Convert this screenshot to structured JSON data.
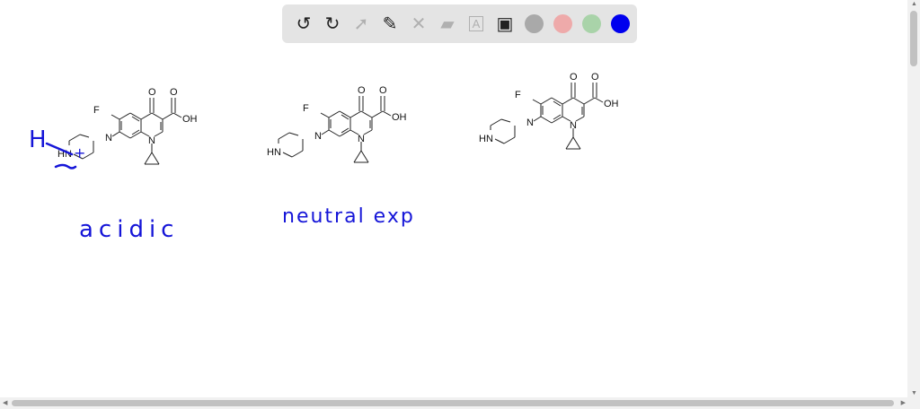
{
  "toolbar": {
    "tools": [
      {
        "name": "undo-icon",
        "glyph": "↺",
        "enabled": true
      },
      {
        "name": "redo-icon",
        "glyph": "↻",
        "enabled": true
      },
      {
        "name": "select-pointer-icon",
        "glyph": "➚",
        "enabled": false
      },
      {
        "name": "pen-icon",
        "glyph": "✎",
        "enabled": true
      },
      {
        "name": "tools-icon",
        "glyph": "✕",
        "enabled": false
      },
      {
        "name": "eraser-icon",
        "glyph": "▰",
        "enabled": false
      },
      {
        "name": "text-icon",
        "glyph": "A",
        "enabled": false
      },
      {
        "name": "image-icon",
        "glyph": "▣",
        "enabled": true
      }
    ],
    "colors": [
      "#a9a9a9",
      "#eeaaaa",
      "#a9d3a9",
      "#0000ee"
    ],
    "active_color": "#0000ee"
  },
  "molecules": [
    {
      "labels": {
        "ketone_o": "O",
        "acid_o": "O",
        "oh": "OH",
        "f": "F",
        "n1": "N",
        "pip_n": "N",
        "pip_nh": "HN"
      }
    },
    {
      "labels": {
        "ketone_o": "O",
        "acid_o": "O",
        "oh": "OH",
        "f": "F",
        "n1": "N",
        "pip_n": "N",
        "pip_nh": "HN"
      }
    },
    {
      "labels": {
        "ketone_o": "O",
        "acid_o": "O",
        "oh": "OH",
        "f": "F",
        "n1": "N",
        "pip_n": "N",
        "pip_nh": "HN"
      }
    }
  ],
  "annotations": {
    "h_mark": "H",
    "plus_mark": "+",
    "label1": "acidic",
    "label2": "neutral exp"
  },
  "colors": {
    "ink": "#1515d8",
    "toolbar_bg": "#e4e4e4"
  }
}
